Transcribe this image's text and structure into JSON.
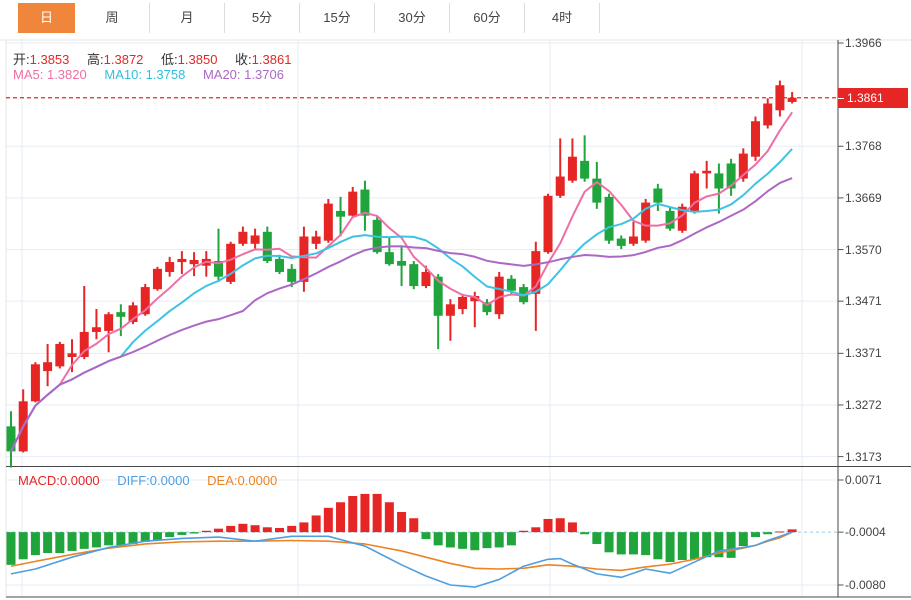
{
  "toolbar": {
    "tabs": [
      {
        "label": "日",
        "active": true
      },
      {
        "label": "周",
        "active": false
      },
      {
        "label": "月",
        "active": false
      },
      {
        "label": "5分",
        "active": false
      },
      {
        "label": "15分",
        "active": false
      },
      {
        "label": "30分",
        "active": false
      },
      {
        "label": "60分",
        "active": false
      },
      {
        "label": "4时",
        "active": false
      }
    ]
  },
  "legend": {
    "ohlc": [
      {
        "label": "开:",
        "value": "1.3853"
      },
      {
        "label": "高:",
        "value": "1.3872"
      },
      {
        "label": "低:",
        "value": "1.3850"
      },
      {
        "label": "收:",
        "value": "1.3861"
      }
    ],
    "ma": [
      {
        "label": "MA5:",
        "value": "1.3820",
        "color": "#ee6fa5"
      },
      {
        "label": "MA10:",
        "value": "1.3758",
        "color": "#2fbfdc"
      },
      {
        "label": "MA20:",
        "value": "1.3706",
        "color": "#ad68c5"
      }
    ],
    "macd": [
      {
        "label": "MACD:",
        "value": "0.0000",
        "color": "#e62525"
      },
      {
        "label": "DIFF:",
        "value": "0.0000",
        "color": "#4f9fe0"
      },
      {
        "label": "DEA:",
        "value": "0.0000",
        "color": "#ee8322"
      }
    ]
  },
  "colors": {
    "up": "#e62525",
    "down": "#20a43c",
    "ma5": "#ee6fa5",
    "ma10": "#3fc3e2",
    "ma20": "#ad68c5",
    "diff": "#4f9fe0",
    "dea": "#ee8322",
    "accent_tab": "#ef863b",
    "grid": "#e6edf4",
    "zero_dash": "#a9d4ee",
    "frame": "#474747",
    "light_border": "#e4e4e4",
    "price_flag_bg": "#e62525"
  },
  "chart_data": {
    "type": "candlestick",
    "main": {
      "title": "",
      "y_ticks": [
        "1.3966",
        "1.3768",
        "1.3669",
        "1.3570",
        "1.3471",
        "1.3371",
        "1.3272",
        "1.3173"
      ],
      "price_top": 1.3966,
      "price_bottom": 1.3173,
      "current_price": 1.3861,
      "current_price_label": "1.3861",
      "ma_periods": [
        5,
        10,
        20
      ],
      "grid_x": [
        22,
        298,
        550,
        802
      ],
      "candles": [
        [
          1.3231,
          1.326,
          1.3152,
          1.3183
        ],
        [
          1.3183,
          1.3302,
          1.3181,
          1.3279
        ],
        [
          1.3279,
          1.3354,
          1.3277,
          1.335
        ],
        [
          1.3337,
          1.3389,
          1.3308,
          1.3354
        ],
        [
          1.3346,
          1.3393,
          1.3342,
          1.3389
        ],
        [
          1.3364,
          1.3398,
          1.3335,
          1.3371
        ],
        [
          1.3364,
          1.35,
          1.336,
          1.3412
        ],
        [
          1.3412,
          1.3456,
          1.3398,
          1.3421
        ],
        [
          1.3414,
          1.345,
          1.3373,
          1.3446
        ],
        [
          1.345,
          1.3465,
          1.3404,
          1.3441
        ],
        [
          1.3431,
          1.3469,
          1.3427,
          1.3463
        ],
        [
          1.3446,
          1.3504,
          1.3443,
          1.3498
        ],
        [
          1.3494,
          1.3537,
          1.3491,
          1.3533
        ],
        [
          1.3527,
          1.3556,
          1.3518,
          1.3546
        ],
        [
          1.3546,
          1.3567,
          1.3523,
          1.3552
        ],
        [
          1.3542,
          1.3565,
          1.3519,
          1.355
        ],
        [
          1.3539,
          1.3567,
          1.3518,
          1.3552
        ],
        [
          1.3548,
          1.361,
          1.3508,
          1.3518
        ],
        [
          1.3508,
          1.3585,
          1.3504,
          1.3581
        ],
        [
          1.3581,
          1.3614,
          1.3577,
          1.3604
        ],
        [
          1.3581,
          1.361,
          1.3571,
          1.3597
        ],
        [
          1.3604,
          1.3614,
          1.3544,
          1.3548
        ],
        [
          1.3552,
          1.356,
          1.3523,
          1.3527
        ],
        [
          1.3533,
          1.3542,
          1.3498,
          1.3508
        ],
        [
          1.3508,
          1.3614,
          1.3489,
          1.3595
        ],
        [
          1.3581,
          1.3606,
          1.3571,
          1.3595
        ],
        [
          1.3587,
          1.3667,
          1.3583,
          1.3658
        ],
        [
          1.3644,
          1.3671,
          1.3595,
          1.3633
        ],
        [
          1.3635,
          1.369,
          1.3631,
          1.3681
        ],
        [
          1.3685,
          1.3702,
          1.3606,
          1.3635
        ],
        [
          1.3627,
          1.3633,
          1.3562,
          1.3565
        ],
        [
          1.3565,
          1.3595,
          1.3539,
          1.3542
        ],
        [
          1.3548,
          1.3577,
          1.35,
          1.3539
        ],
        [
          1.3542,
          1.3548,
          1.3494,
          1.35
        ],
        [
          1.35,
          1.3539,
          1.3496,
          1.3527
        ],
        [
          1.3518,
          1.3523,
          1.3379,
          1.3443
        ],
        [
          1.3443,
          1.3475,
          1.3395,
          1.3465
        ],
        [
          1.3456,
          1.3485,
          1.3446,
          1.3479
        ],
        [
          1.3471,
          1.3489,
          1.3421,
          1.3481
        ],
        [
          1.3469,
          1.3475,
          1.3444,
          1.345
        ],
        [
          1.3446,
          1.3527,
          1.3437,
          1.3518
        ],
        [
          1.3514,
          1.3521,
          1.3485,
          1.3491
        ],
        [
          1.3498,
          1.3504,
          1.3465,
          1.3469
        ],
        [
          1.3485,
          1.3585,
          1.3414,
          1.3567
        ],
        [
          1.3565,
          1.3677,
          1.3562,
          1.3673
        ],
        [
          1.3673,
          1.3783,
          1.3669,
          1.371
        ],
        [
          1.3702,
          1.3783,
          1.3698,
          1.3748
        ],
        [
          1.374,
          1.3789,
          1.37,
          1.3706
        ],
        [
          1.3706,
          1.3738,
          1.3648,
          1.366
        ],
        [
          1.3671,
          1.3677,
          1.3581,
          1.3587
        ],
        [
          1.3591,
          1.3597,
          1.3571,
          1.3577
        ],
        [
          1.3581,
          1.3623,
          1.3577,
          1.3595
        ],
        [
          1.3587,
          1.3667,
          1.3583,
          1.366
        ],
        [
          1.3687,
          1.3696,
          1.3644,
          1.366
        ],
        [
          1.3644,
          1.3652,
          1.3606,
          1.361
        ],
        [
          1.3606,
          1.3658,
          1.3602,
          1.3652
        ],
        [
          1.3642,
          1.3721,
          1.3639,
          1.3716
        ],
        [
          1.3716,
          1.374,
          1.3687,
          1.3721
        ],
        [
          1.3716,
          1.3735,
          1.3639,
          1.3687
        ],
        [
          1.3735,
          1.3744,
          1.3673,
          1.3687
        ],
        [
          1.3706,
          1.3764,
          1.37,
          1.3754
        ],
        [
          1.3748,
          1.3825,
          1.374,
          1.3816
        ],
        [
          1.3808,
          1.386,
          1.3802,
          1.385
        ],
        [
          1.3837,
          1.3894,
          1.3825,
          1.3885
        ],
        [
          1.3853,
          1.3872,
          1.385,
          1.3861
        ]
      ]
    },
    "macd": {
      "y_ticks": [
        "0.0071",
        "-0.0004",
        "-0.0080"
      ],
      "value_top": 0.0071,
      "value_bottom": -0.008,
      "baseline": -0.0004,
      "hist": [
        -0.0051,
        -0.0043,
        -0.0037,
        -0.0034,
        -0.0034,
        -0.0031,
        -0.0028,
        -0.0026,
        -0.0023,
        -0.0023,
        -0.0021,
        -0.0018,
        -0.0016,
        -0.0011,
        -0.0008,
        -0.0006,
        -0.0002,
        0.0001,
        0.0005,
        0.0008,
        0.0006,
        0.0003,
        0.0002,
        0.0005,
        0.001,
        0.002,
        0.0031,
        0.0039,
        0.0048,
        0.0051,
        0.0051,
        0.0039,
        0.0025,
        0.0016,
        -0.0014,
        -0.0023,
        -0.0026,
        -0.0028,
        -0.003,
        -0.0027,
        -0.0026,
        -0.0023,
        -0.0002,
        0.0003,
        0.0015,
        0.0016,
        0.001,
        -0.0007,
        -0.0021,
        -0.0033,
        -0.0036,
        -0.0036,
        -0.0037,
        -0.0043,
        -0.0047,
        -0.0044,
        -0.0043,
        -0.004,
        -0.004,
        -0.0041,
        -0.0024,
        -0.0011,
        -0.0007,
        -0.0003,
        0.0
      ],
      "diff": [
        [
          0,
          -0.0064
        ],
        [
          2,
          -0.0057
        ],
        [
          5,
          -0.004
        ],
        [
          8,
          -0.0026
        ],
        [
          11,
          -0.0017
        ],
        [
          14,
          -0.0013
        ],
        [
          17,
          -0.0011
        ],
        [
          20,
          -0.0017
        ],
        [
          23,
          -0.001
        ],
        [
          26,
          -0.001
        ],
        [
          29,
          -0.0024
        ],
        [
          32,
          -0.0051
        ],
        [
          34,
          -0.0067
        ],
        [
          36,
          -0.008
        ],
        [
          38,
          -0.0083
        ],
        [
          40,
          -0.0072
        ],
        [
          42,
          -0.0053
        ],
        [
          44,
          -0.0043
        ],
        [
          45,
          -0.0042
        ],
        [
          46,
          -0.005
        ],
        [
          48,
          -0.0064
        ],
        [
          50,
          -0.0069
        ],
        [
          52,
          -0.0057
        ],
        [
          54,
          -0.0063
        ],
        [
          56,
          -0.0047
        ],
        [
          58,
          -0.0031
        ],
        [
          60,
          -0.0026
        ],
        [
          61,
          -0.0023
        ],
        [
          62,
          -0.0016
        ],
        [
          63,
          -0.001
        ],
        [
          64,
          -0.0004
        ]
      ],
      "dea": [
        [
          0,
          -0.0053
        ],
        [
          2,
          -0.0046
        ],
        [
          5,
          -0.0036
        ],
        [
          8,
          -0.0027
        ],
        [
          11,
          -0.0021
        ],
        [
          14,
          -0.0018
        ],
        [
          17,
          -0.0017
        ],
        [
          20,
          -0.0017
        ],
        [
          23,
          -0.0016
        ],
        [
          26,
          -0.0017
        ],
        [
          29,
          -0.0021
        ],
        [
          32,
          -0.0031
        ],
        [
          34,
          -0.004
        ],
        [
          36,
          -0.0049
        ],
        [
          38,
          -0.0056
        ],
        [
          40,
          -0.0057
        ],
        [
          42,
          -0.0056
        ],
        [
          44,
          -0.0051
        ],
        [
          46,
          -0.0053
        ],
        [
          48,
          -0.0057
        ],
        [
          50,
          -0.0059
        ],
        [
          52,
          -0.0054
        ],
        [
          54,
          -0.005
        ],
        [
          56,
          -0.0043
        ],
        [
          58,
          -0.0034
        ],
        [
          60,
          -0.0027
        ],
        [
          61,
          -0.0023
        ],
        [
          62,
          -0.0017
        ],
        [
          63,
          -0.0012
        ],
        [
          64,
          -0.0004
        ]
      ]
    }
  }
}
